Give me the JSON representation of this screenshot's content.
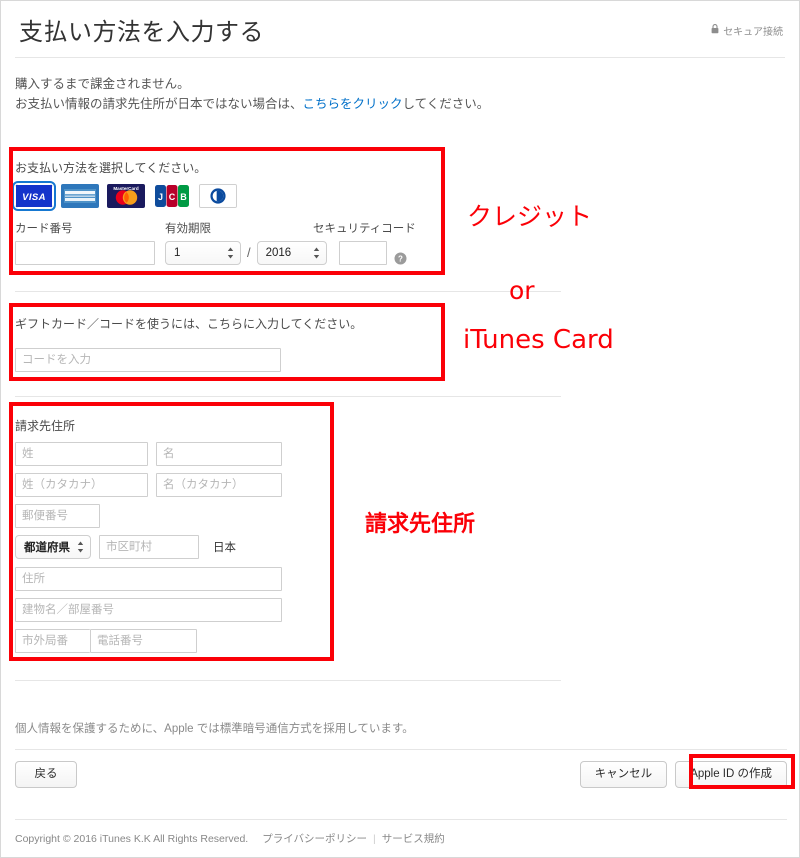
{
  "header": {
    "title": "支払い方法を入力する",
    "secure_label": "セキュア接続",
    "lock_icon": "lock-icon"
  },
  "intro": {
    "line1": "購入するまで課金されません。",
    "line2_before": "お支払い情報の請求先住所が日本ではない場合は、",
    "line2_link": "こちらをクリック",
    "line2_after": "してください。"
  },
  "payment_section": {
    "label": "お支払い方法を選択してください。",
    "brands": [
      {
        "name": "visa-card-icon",
        "label": "VISA",
        "selected": true
      },
      {
        "name": "amex-card-icon",
        "label": "AMERICAN EXPRESS",
        "selected": false
      },
      {
        "name": "mastercard-card-icon",
        "label": "MasterCard",
        "selected": false
      },
      {
        "name": "jcb-card-icon",
        "label": "JCB",
        "selected": false
      },
      {
        "name": "diners-club-card-icon",
        "label": "Diners Club",
        "selected": false
      }
    ],
    "card_number_label": "カード番号",
    "card_number_value": "",
    "expiry_label": "有効期限",
    "expiry_month": "1",
    "expiry_year": "2016",
    "expiry_separator": "/",
    "security_code_label": "セキュリティコード",
    "security_code_value": "",
    "help_icon": "help-circle-icon"
  },
  "giftcard_section": {
    "label": "ギフトカード／コードを使うには、こちらに入力してください。",
    "input_placeholder": "コードを入力",
    "input_value": ""
  },
  "billing_section": {
    "label": "請求先住所",
    "last_name_placeholder": "姓",
    "first_name_placeholder": "名",
    "last_name_kana_placeholder": "姓（カタカナ）",
    "first_name_kana_placeholder": "名（カタカナ）",
    "postal_placeholder": "郵便番号",
    "prefecture_value": "都道府県",
    "city_placeholder": "市区町村",
    "country_label": "日本",
    "address_placeholder": "住所",
    "building_placeholder": "建物名／部屋番号",
    "area_code_placeholder": "市外局番",
    "phone_placeholder": "電話番号"
  },
  "annotations": {
    "credit": "クレジット",
    "or": "or",
    "itunes_card": "iTunes Card",
    "billing_address": "請求先住所"
  },
  "footer": {
    "privacy_note": "個人情報を保護するために、Apple では標準暗号通信方式を採用しています。",
    "back_button": "戻る",
    "cancel_button": "キャンセル",
    "submit_button": "Apple ID の作成",
    "copyright": "Copyright © 2016 iTunes K.K All Rights Reserved.",
    "privacy_link": "プライバシーポリシー",
    "terms_link": "サービス規約"
  },
  "colors": {
    "annotation_red": "#fb0007",
    "link_blue": "#0070c9",
    "selected_outline": "#1678d1"
  }
}
